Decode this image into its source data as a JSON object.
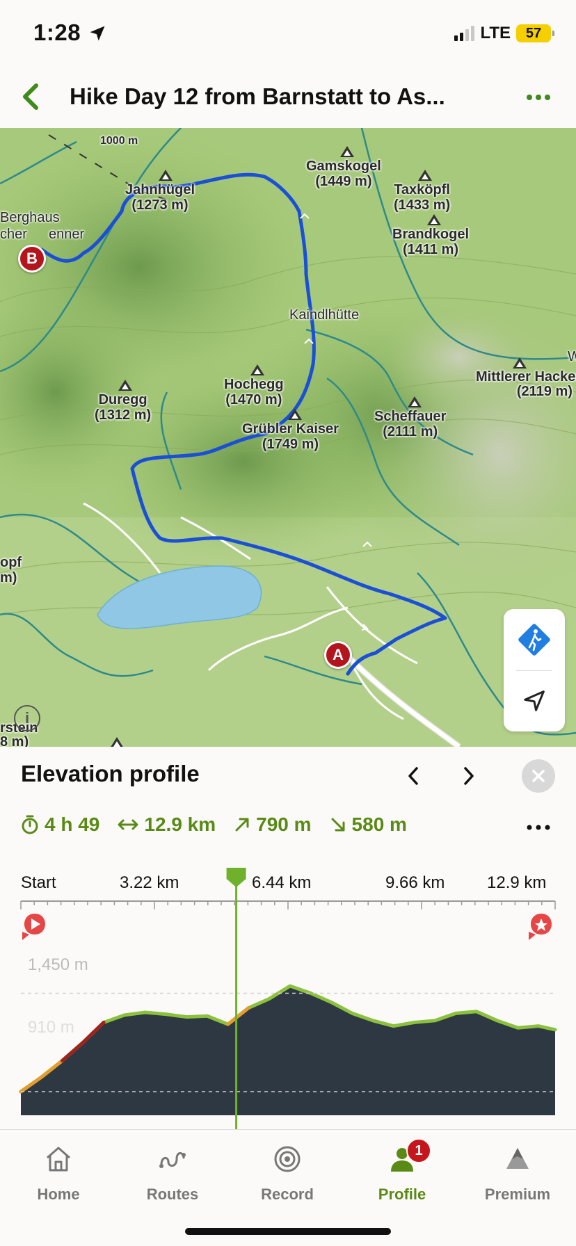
{
  "status_bar": {
    "time": "1:28",
    "network": "LTE",
    "battery": "57"
  },
  "header": {
    "title": "Hike Day 12 from Barnstatt to As..."
  },
  "map": {
    "scale_label": "1000 m",
    "peaks": [
      {
        "name": "Gamskogel",
        "elev": "(1449 m)"
      },
      {
        "name": "Taxköpfl",
        "elev": "(1433 m)"
      },
      {
        "name": "Brandkogel",
        "elev": "(1411 m)"
      },
      {
        "name": "Jahnhügel",
        "elev": "(1273 m)"
      },
      {
        "name": "Hochegg",
        "elev": "(1470 m)"
      },
      {
        "name": "Duregg",
        "elev": "(1312 m)"
      },
      {
        "name": "Grübler Kaiser",
        "elev": "(1749 m)"
      },
      {
        "name": "Scheffauer",
        "elev": "(2111 m)"
      },
      {
        "name": "Mittlerer Hackenkopf",
        "elev": "(2119 m)"
      }
    ],
    "hut_label": "Kaindlhütte",
    "edge_labels": [
      "Berghaus",
      "cher",
      "enner",
      "opf",
      "m)",
      "rstein",
      "8 m)",
      "W"
    ],
    "marker_start": "A",
    "marker_end": "B",
    "route_color": "#1a4fd6"
  },
  "elevation": {
    "title": "Elevation profile",
    "stats": {
      "duration": "4 h 49",
      "distance": "12.9 km",
      "ascent": "790 m",
      "descent": "580 m"
    },
    "x_axis": [
      "Start",
      "3.22 km",
      "6.44 km",
      "9.66 km",
      "12.9 km"
    ],
    "y_labels": [
      "1,450 m",
      "910 m"
    ]
  },
  "chart_data": {
    "type": "area",
    "x": [
      0,
      0.5,
      1,
      1.5,
      2,
      2.5,
      3,
      3.5,
      4,
      4.5,
      5,
      5.5,
      6,
      6.5,
      7,
      7.5,
      8,
      8.5,
      9,
      9.5,
      10,
      10.5,
      11,
      11.5,
      12,
      12.5,
      12.9
    ],
    "y": [
      910,
      990,
      1080,
      1180,
      1290,
      1330,
      1345,
      1335,
      1320,
      1325,
      1280,
      1370,
      1420,
      1490,
      1450,
      1400,
      1340,
      1300,
      1270,
      1290,
      1300,
      1340,
      1350,
      1300,
      1260,
      1270,
      1250
    ],
    "xlabel": "",
    "ylabel": "",
    "xlim": [
      0,
      12.9
    ],
    "ylim": [
      780,
      1620
    ],
    "x_ticks": [
      "Start",
      "3.22 km",
      "6.44 km",
      "9.66 km",
      "12.9 km"
    ],
    "y_gridlines": [
      1450,
      910
    ],
    "cursor_x": 5.2,
    "fill_color": "#2d3843",
    "line_color": "#8cc13e"
  },
  "tabs": [
    {
      "label": "Home"
    },
    {
      "label": "Routes"
    },
    {
      "label": "Record"
    },
    {
      "label": "Profile",
      "badge": "1"
    },
    {
      "label": "Premium"
    }
  ],
  "colors": {
    "accent": "#5a8a16",
    "badge": "#c4161c"
  }
}
